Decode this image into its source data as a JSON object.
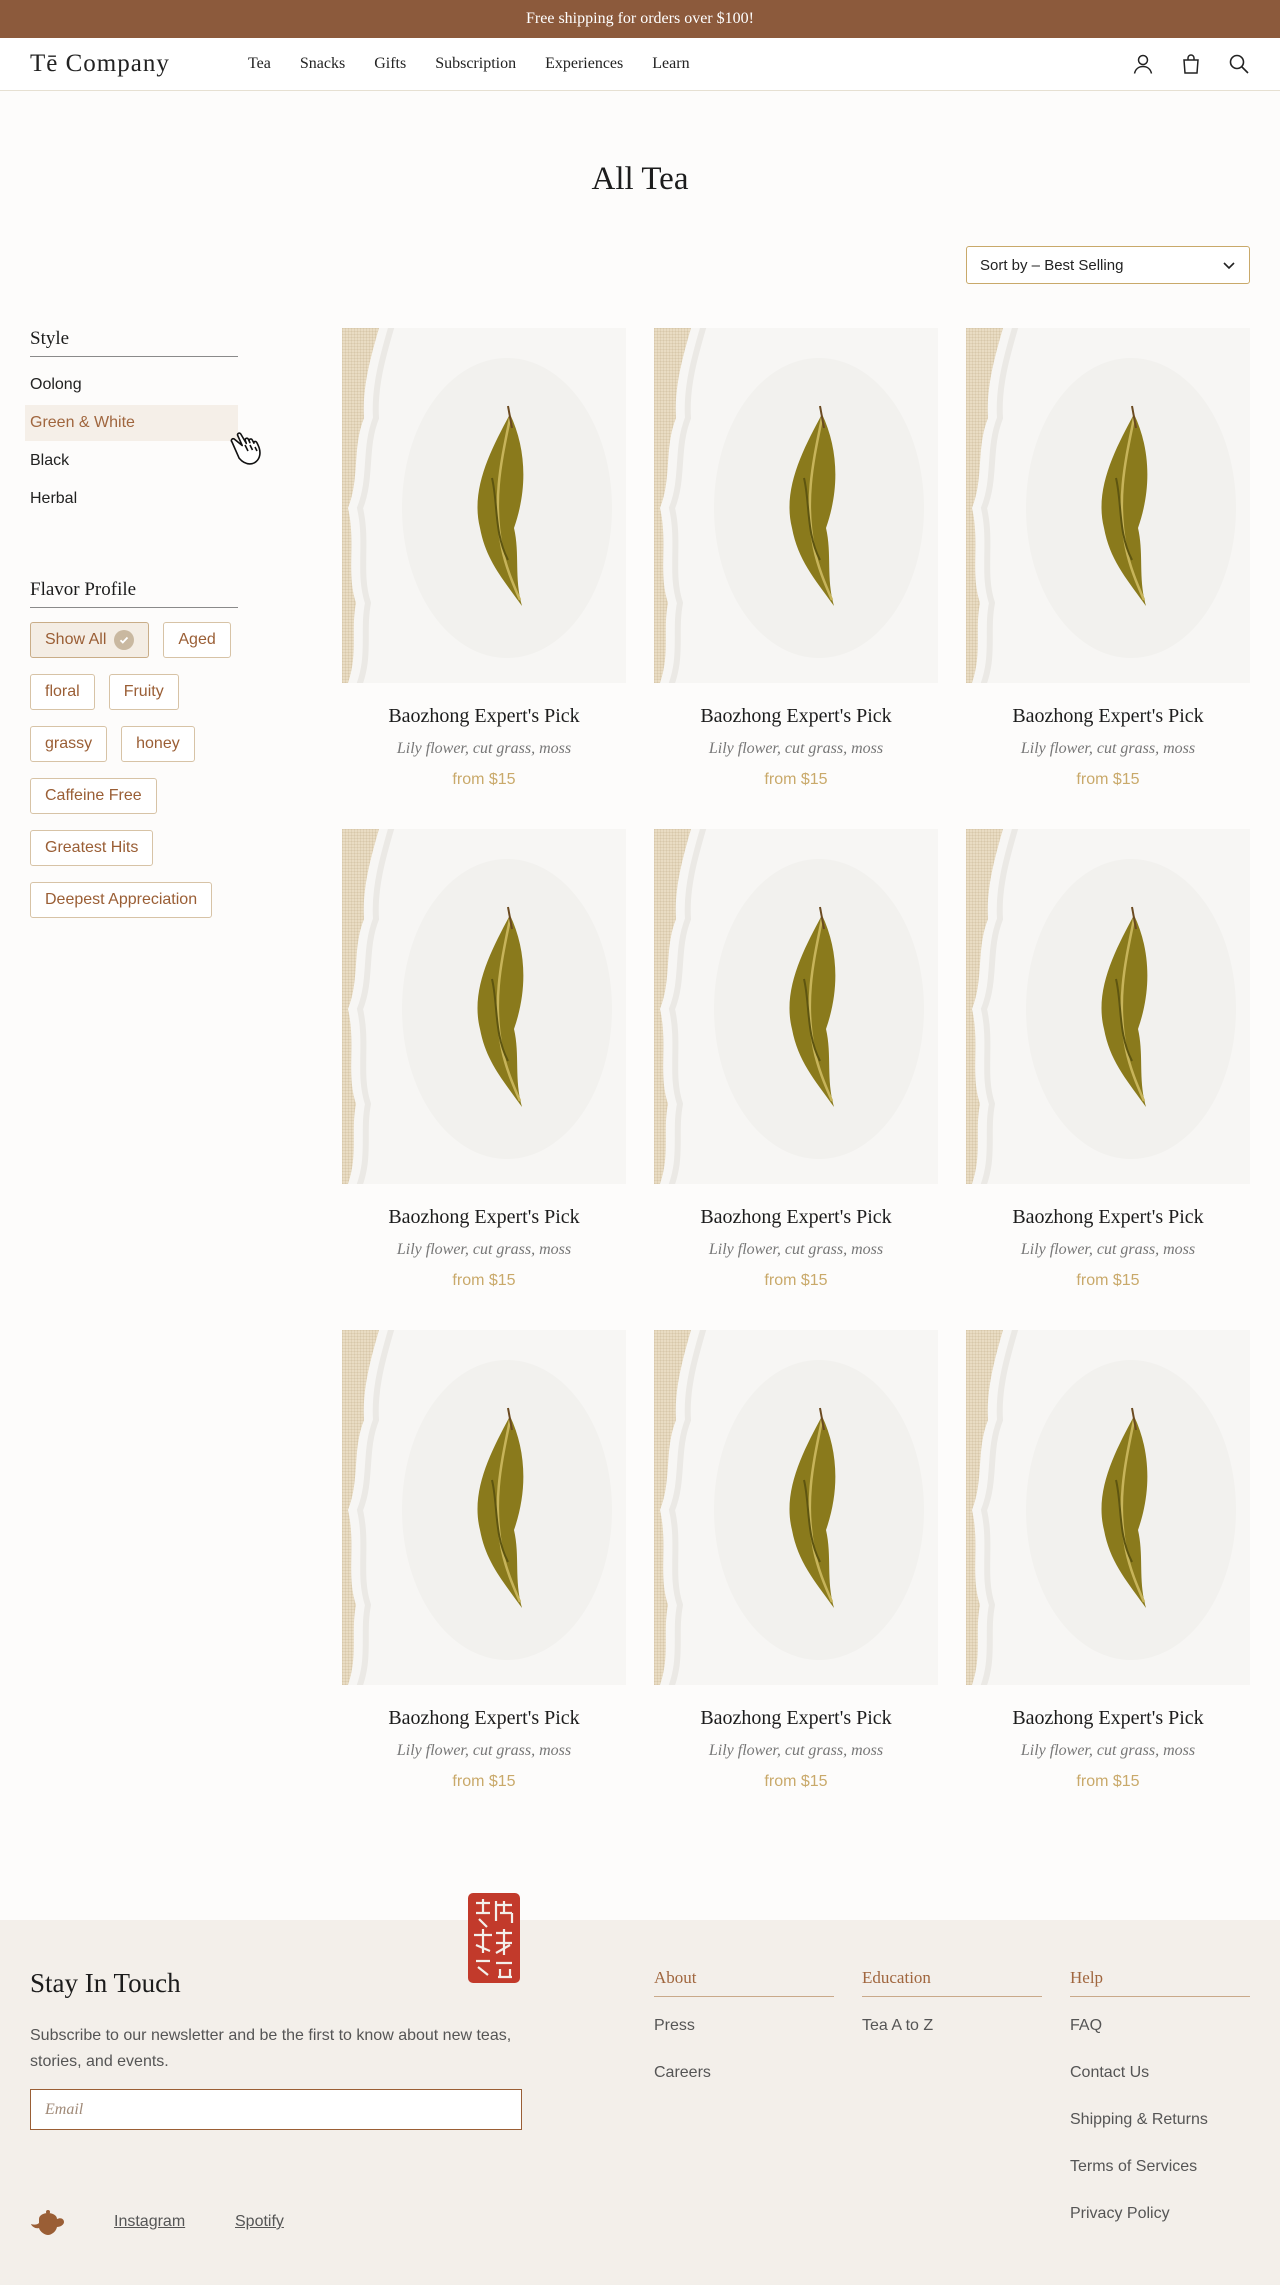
{
  "announcement": "Free shipping for orders over $100!",
  "header": {
    "logo": "Tē Company",
    "nav": [
      "Tea",
      "Snacks",
      "Gifts",
      "Subscription",
      "Experiences",
      "Learn"
    ],
    "icons": [
      "account-icon",
      "bag-icon",
      "search-icon"
    ]
  },
  "page": {
    "title": "All Tea",
    "sort_label": "Sort by – Best Selling"
  },
  "sidebar": {
    "style_heading": "Style",
    "styles": [
      {
        "label": "Oolong",
        "active": false
      },
      {
        "label": "Green & White",
        "active": true
      },
      {
        "label": "Black",
        "active": false
      },
      {
        "label": "Herbal",
        "active": false
      }
    ],
    "flavor_heading": "Flavor Profile",
    "flavors": [
      {
        "label": "Show All",
        "selected": true
      },
      {
        "label": "Aged",
        "selected": false
      },
      {
        "label": "floral",
        "selected": false
      },
      {
        "label": "Fruity",
        "selected": false
      },
      {
        "label": "grassy",
        "selected": false
      },
      {
        "label": "honey",
        "selected": false
      },
      {
        "label": "Caffeine Free",
        "selected": false
      },
      {
        "label": "Greatest Hits",
        "selected": false
      },
      {
        "label": "Deepest Appreciation",
        "selected": false
      }
    ]
  },
  "products": [
    {
      "name": "Baozhong Expert's Pick",
      "notes": "Lily flower, cut grass, moss",
      "price": "from $15"
    },
    {
      "name": "Baozhong Expert's Pick",
      "notes": "Lily flower, cut grass, moss",
      "price": "from $15"
    },
    {
      "name": "Baozhong Expert's Pick",
      "notes": "Lily flower, cut grass, moss",
      "price": "from $15"
    },
    {
      "name": "Baozhong Expert's Pick",
      "notes": "Lily flower, cut grass, moss",
      "price": "from $15"
    },
    {
      "name": "Baozhong Expert's Pick",
      "notes": "Lily flower, cut grass, moss",
      "price": "from $15"
    },
    {
      "name": "Baozhong Expert's Pick",
      "notes": "Lily flower, cut grass, moss",
      "price": "from $15"
    },
    {
      "name": "Baozhong Expert's Pick",
      "notes": "Lily flower, cut grass, moss",
      "price": "from $15"
    },
    {
      "name": "Baozhong Expert's Pick",
      "notes": "Lily flower, cut grass, moss",
      "price": "from $15"
    },
    {
      "name": "Baozhong Expert's Pick",
      "notes": "Lily flower, cut grass, moss",
      "price": "from $15"
    }
  ],
  "footer": {
    "title": "Stay In Touch",
    "text": "Subscribe to our newsletter and be the first to know about new teas, stories, and events.",
    "email_placeholder": "Email",
    "social": [
      "Instagram",
      "Spotify"
    ],
    "columns": [
      {
        "heading": "About",
        "links": [
          "Press",
          "Careers"
        ]
      },
      {
        "heading": "Education",
        "links": [
          "Tea A to Z"
        ]
      },
      {
        "heading": "Help",
        "links": [
          "FAQ",
          "Contact Us",
          "Shipping & Returns",
          "Terms of Services",
          "Privacy Policy"
        ]
      }
    ]
  },
  "colors": {
    "brand_brown": "#8c5a3c",
    "accent_gold": "#c9a96a",
    "seal_red": "#c23a2b"
  }
}
